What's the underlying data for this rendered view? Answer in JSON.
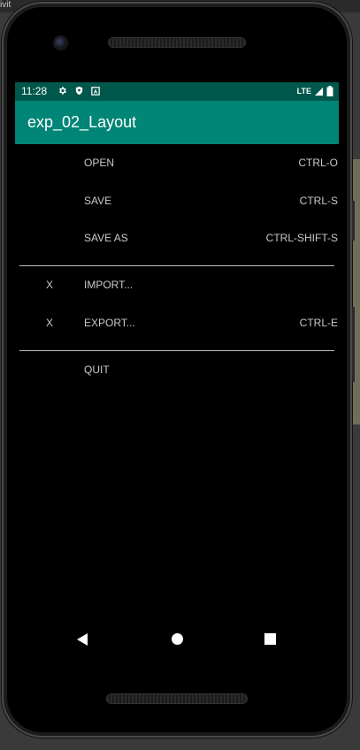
{
  "window_title_fragment": "ivit",
  "status_bar": {
    "time": "11:28",
    "network": "LTE",
    "icons_left": [
      "gear-icon",
      "shield-icon",
      "letter-a-icon"
    ],
    "icons_right": [
      "signal-icon",
      "battery-icon"
    ]
  },
  "app_bar": {
    "title": "exp_02_Layout",
    "color": "#008577",
    "status_color": "#00574b"
  },
  "menu": {
    "items": [
      {
        "check": "",
        "label": "OPEN",
        "shortcut": "CTRL-O"
      },
      {
        "check": "",
        "label": "SAVE",
        "shortcut": "CTRL-S"
      },
      {
        "check": "",
        "label": "SAVE AS",
        "shortcut": "CTRL-SHIFT-S"
      },
      {
        "check": "X",
        "label": "IMPORT...",
        "shortcut": ""
      },
      {
        "check": "X",
        "label": "EXPORT...",
        "shortcut": "CTRL-E"
      },
      {
        "check": "",
        "label": "QUIT",
        "shortcut": ""
      }
    ]
  },
  "nav_bar": {
    "buttons": [
      "back-icon",
      "home-icon",
      "recents-icon"
    ]
  }
}
